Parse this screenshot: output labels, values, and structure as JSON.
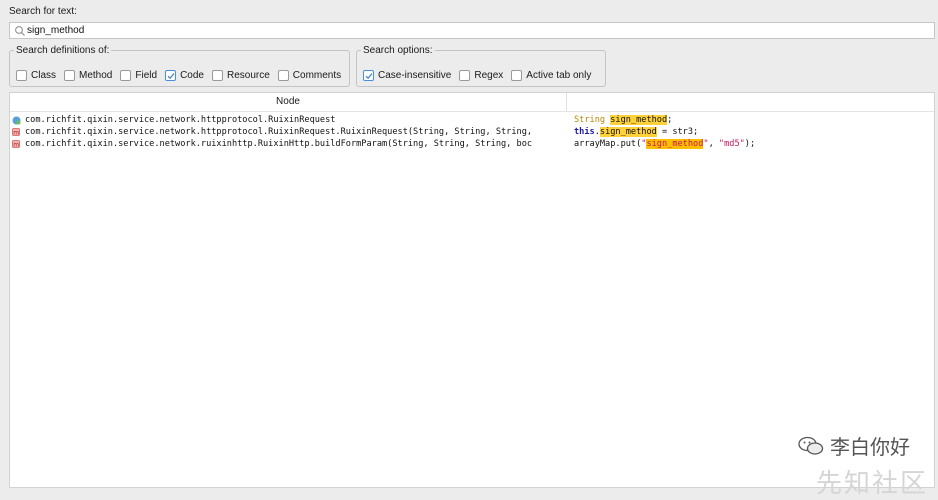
{
  "search": {
    "label": "Search for text:",
    "value": "sign_method"
  },
  "definitions": {
    "legend": "Search definitions of:",
    "options": [
      {
        "label": "Class",
        "checked": false
      },
      {
        "label": "Method",
        "checked": false
      },
      {
        "label": "Field",
        "checked": false
      },
      {
        "label": "Code",
        "checked": true
      },
      {
        "label": "Resource",
        "checked": false
      },
      {
        "label": "Comments",
        "checked": false
      }
    ]
  },
  "search_options": {
    "legend": "Search options:",
    "options": [
      {
        "label": "Case-insensitive",
        "checked": true
      },
      {
        "label": "Regex",
        "checked": false
      },
      {
        "label": "Active tab only",
        "checked": false
      }
    ]
  },
  "table": {
    "col_node": "Node",
    "rows": [
      {
        "icon": "class-icon",
        "node": "com.richfit.qixin.service.network.httpprotocol.RuixinRequest",
        "code": {
          "before_kw": "String",
          "kw_style": "type",
          "pre": " ",
          "match": "sign_method",
          "post": ";"
        }
      },
      {
        "icon": "method-icon",
        "node": "com.richfit.qixin.service.network.httpprotocol.RuixinRequest.RuixinRequest(String, String, String,",
        "code": {
          "before_kw": "this",
          "kw_style": "this",
          "pre": ".",
          "match": "sign_method",
          "post": " = str3;"
        }
      },
      {
        "icon": "method-icon",
        "node": "com.richfit.qixin.service.network.ruixinhttp.RuixinHttp.buildFormParam(String, String, String, boc",
        "code": {
          "before_kw": "arrayMap.put(",
          "kw_style": "plain",
          "pre": "\"",
          "match": "sign_method",
          "post": "\", \"md5\");"
        }
      }
    ]
  },
  "watermark": {
    "text": "李白你好",
    "icon": "wechat-icon",
    "faint_text": "先知社区"
  }
}
